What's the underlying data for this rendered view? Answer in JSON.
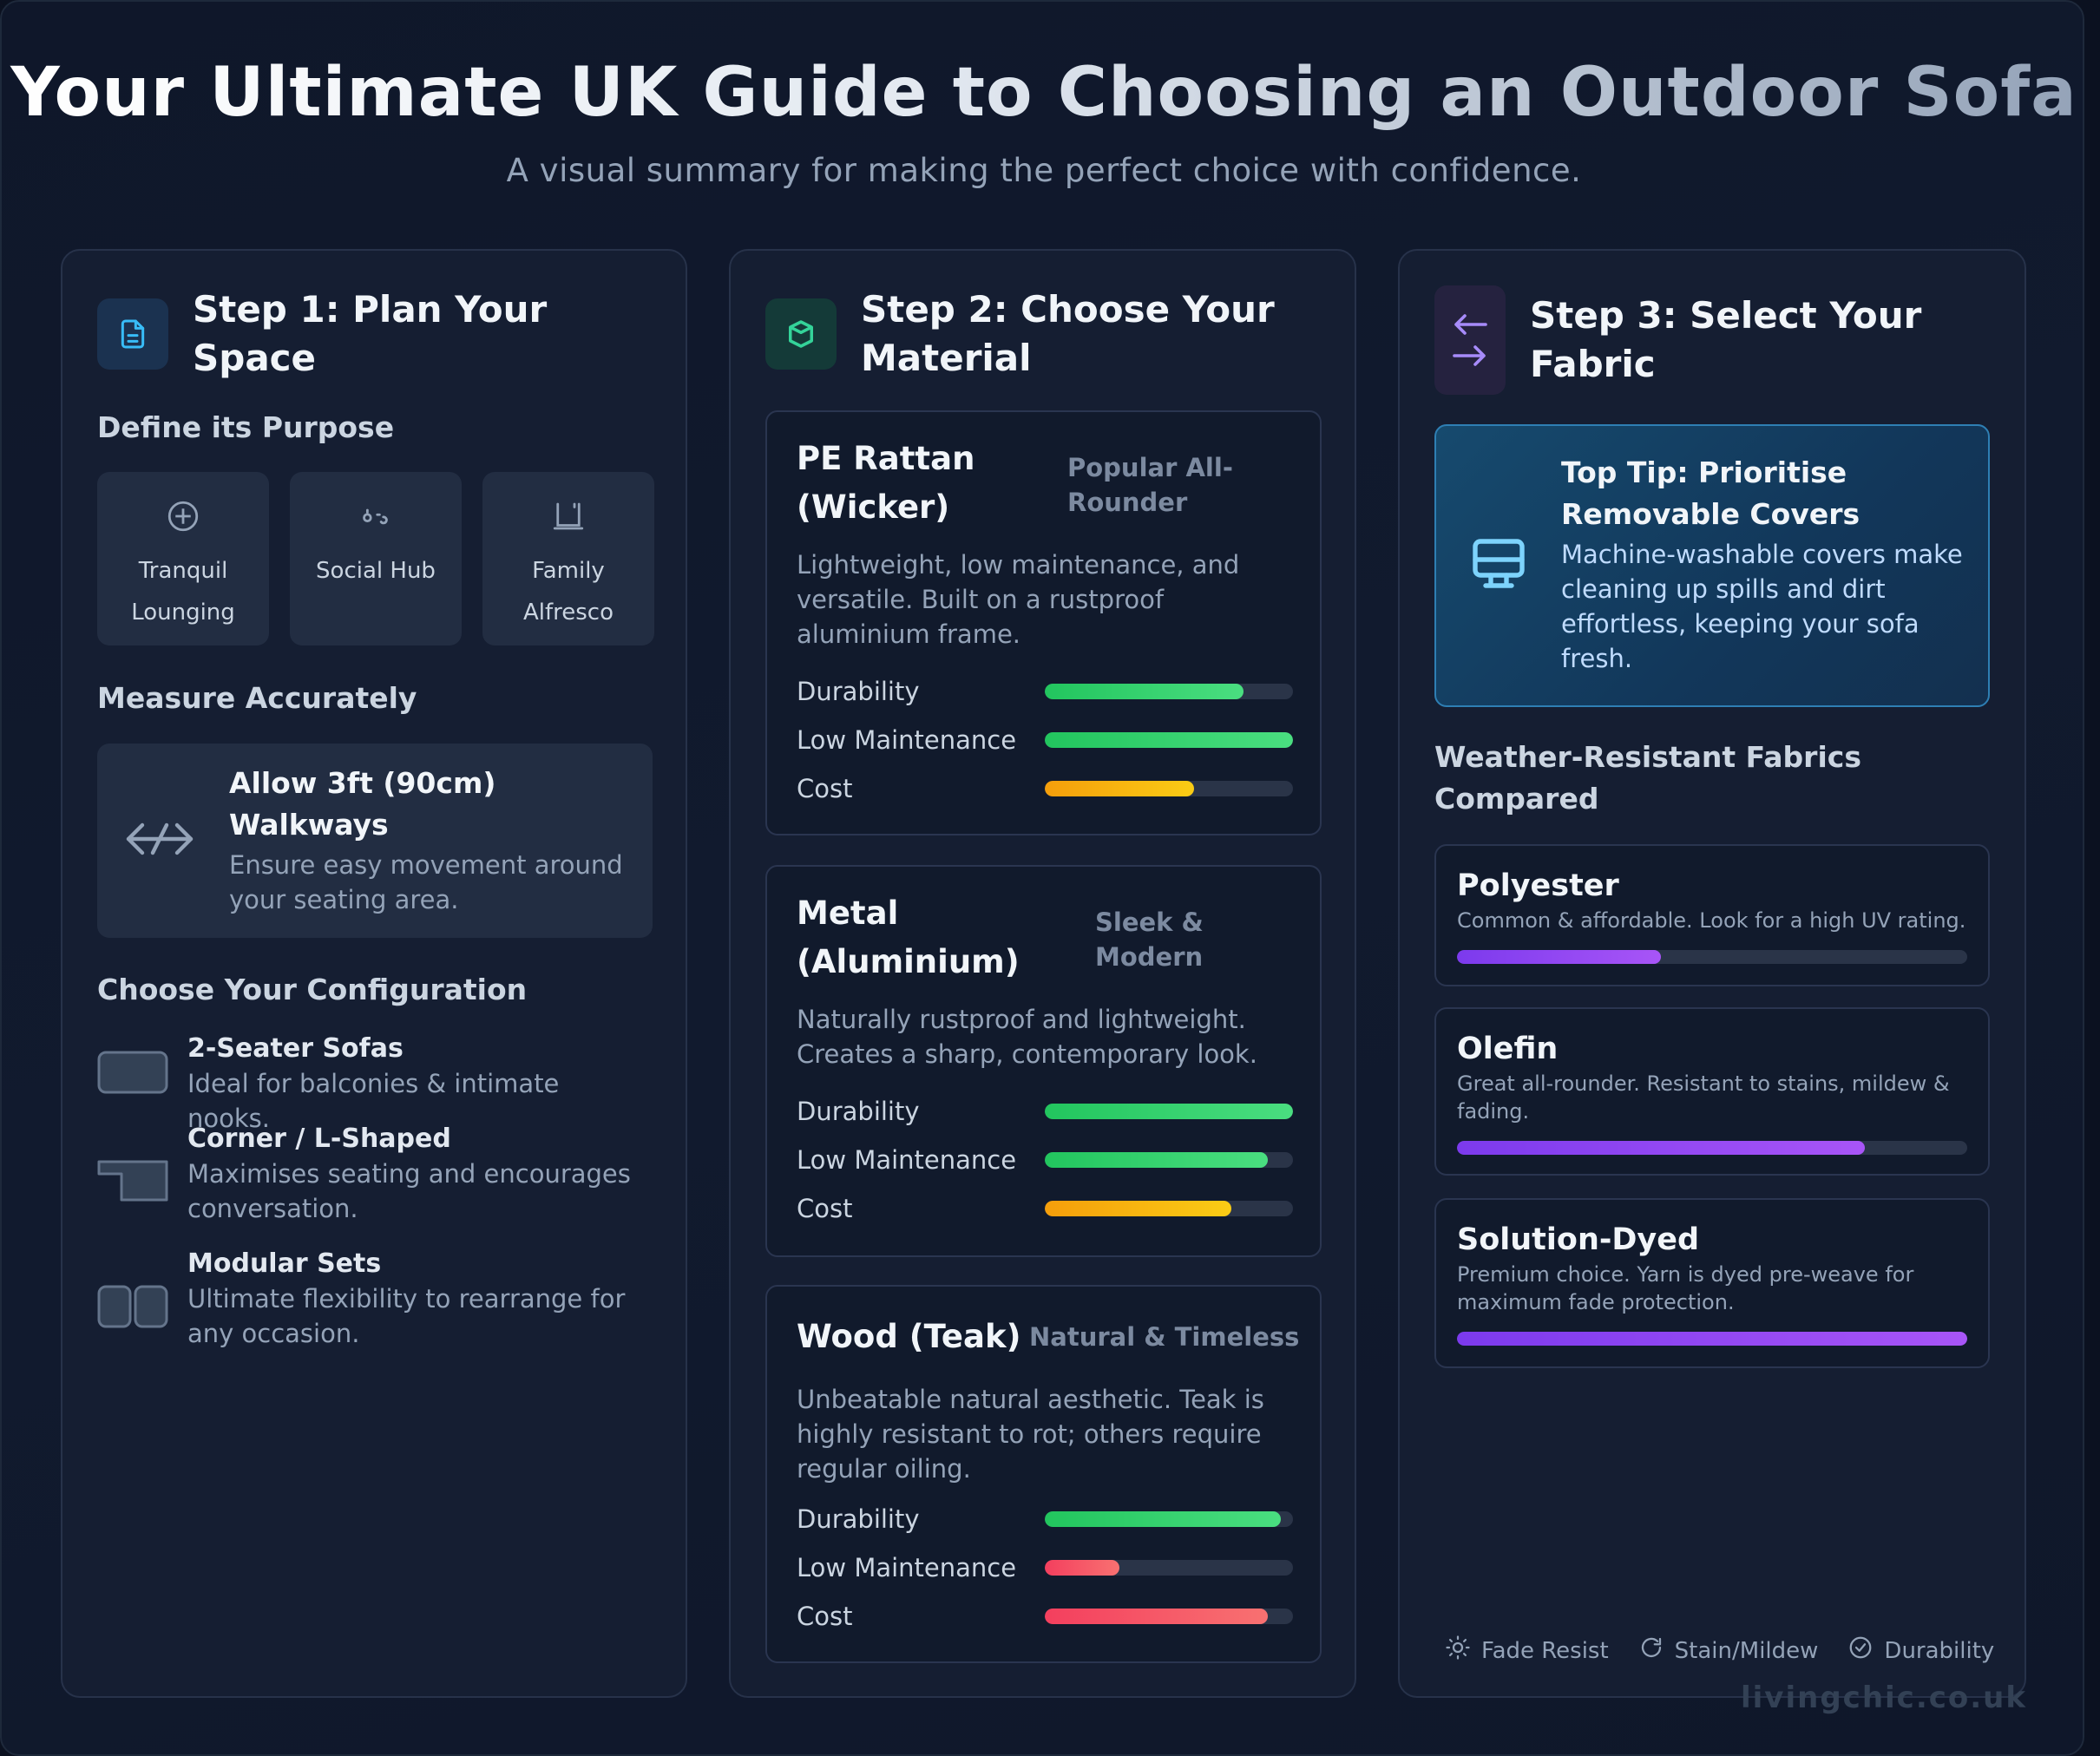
{
  "header": {
    "title": "Your Ultimate UK Guide to Choosing an Outdoor Sofa",
    "subtitle": "A visual summary for making the perfect choice with confidence."
  },
  "step1": {
    "title": "Step 1: Plan Your Space",
    "icon": "document-icon",
    "purpose_heading": "Define its Purpose",
    "purposes": [
      {
        "label": "Tranquil Lounging",
        "icon": "plus-circle-icon"
      },
      {
        "label": "Social Hub",
        "icon": "social-icon"
      },
      {
        "label": "Family Alfresco",
        "icon": "table-icon"
      }
    ],
    "measure_heading": "Measure Accurately",
    "measure": {
      "title": "Allow 3ft (90cm) Walkways",
      "desc": "Ensure easy movement around your seating area.",
      "icon": "arrows-horizontal-icon"
    },
    "config_heading": "Choose Your Configuration",
    "configs": [
      {
        "title": "2-Seater Sofas",
        "desc": "Ideal for balconies & intimate nooks.",
        "icon": "two-seater-icon"
      },
      {
        "title": "Corner / L-Shaped",
        "desc": "Maximises seating and encourages conversation.",
        "icon": "corner-sofa-icon"
      },
      {
        "title": "Modular Sets",
        "desc": "Ultimate flexibility to rearrange for any occasion.",
        "icon": "modular-icon"
      }
    ]
  },
  "step2": {
    "title": "Step 2: Choose Your Material",
    "icon": "hexagon-icon",
    "materials": [
      {
        "name": "PE Rattan (Wicker)",
        "tag": "Popular All-Rounder",
        "desc": "Lightweight, low maintenance, and versatile. Built on a rustproof aluminium frame.",
        "ratings": [
          {
            "label": "Durability",
            "value": 0.8,
            "color": "green"
          },
          {
            "label": "Low Maintenance",
            "value": 1.0,
            "color": "green"
          },
          {
            "label": "Cost",
            "value": 0.6,
            "color": "yellow"
          }
        ]
      },
      {
        "name": "Metal (Aluminium)",
        "tag": "Sleek & Modern",
        "desc": "Naturally rustproof and lightweight. Creates a sharp, contemporary look.",
        "ratings": [
          {
            "label": "Durability",
            "value": 1.0,
            "color": "green"
          },
          {
            "label": "Low Maintenance",
            "value": 0.9,
            "color": "green"
          },
          {
            "label": "Cost",
            "value": 0.75,
            "color": "yellow"
          }
        ]
      },
      {
        "name": "Wood (Teak)",
        "tag": "Natural & Timeless",
        "desc": "Unbeatable natural aesthetic. Teak is highly resistant to rot; others require regular oiling.",
        "ratings": [
          {
            "label": "Durability",
            "value": 0.95,
            "color": "green"
          },
          {
            "label": "Low Maintenance",
            "value": 0.3,
            "color": "red"
          },
          {
            "label": "Cost",
            "value": 0.9,
            "color": "red"
          }
        ]
      }
    ]
  },
  "step3": {
    "title": "Step 3: Select Your Fabric",
    "icon": "arrows-exchange-icon",
    "tip": {
      "title": "Top Tip: Prioritise Removable Covers",
      "desc": "Machine-washable covers make cleaning up spills and dirt effortless, keeping your sofa fresh.",
      "icon": "washing-machine-icon"
    },
    "fabrics_heading": "Weather-Resistant Fabrics Compared",
    "fabrics": [
      {
        "name": "Polyester",
        "desc": "Common & affordable. Look for a high UV rating.",
        "value": 0.4
      },
      {
        "name": "Olefin",
        "desc": "Great all-rounder. Resistant to stains, mildew & fading.",
        "value": 0.8
      },
      {
        "name": "Solution-Dyed",
        "desc": "Premium choice. Yarn is dyed pre-weave for maximum fade protection.",
        "value": 1.0
      }
    ],
    "legend": [
      {
        "label": "Fade Resist",
        "icon": "sun-icon"
      },
      {
        "label": "Stain/Mildew",
        "icon": "refresh-icon"
      },
      {
        "label": "Durability",
        "icon": "check-circle-icon"
      }
    ]
  },
  "watermark": "livingchic.co.uk",
  "colors": {
    "background": "#0f172a",
    "card": "#151e32",
    "green": "#22c55e",
    "yellow": "#facc15",
    "red": "#f43f5e",
    "purple": "#a855f7",
    "blue_accent": "#38bdf8"
  }
}
